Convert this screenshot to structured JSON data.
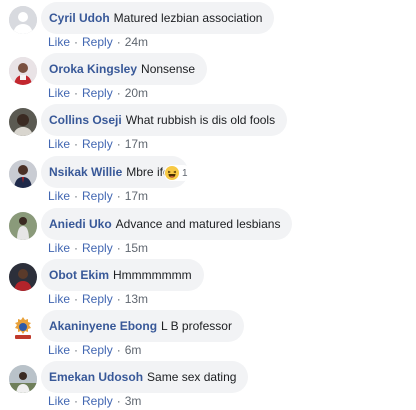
{
  "ui": {
    "like_label": "Like",
    "reply_label": "Reply",
    "separator": "·"
  },
  "comments": [
    {
      "author": "Cyril Udoh",
      "text": "Matured lezbian association",
      "time": "24m",
      "avatar_icon": "generic-user-icon"
    },
    {
      "author": "Oroka Kingsley",
      "text": "Nonsense",
      "time": "20m",
      "avatar_icon": "user-photo-red-shirt"
    },
    {
      "author": "Collins Oseji",
      "text": "What rubbish is dis old fools",
      "time": "17m",
      "avatar_icon": "user-photo-dark"
    },
    {
      "author": "Nsikak Willie",
      "text": "Mbre ifod",
      "time": "17m",
      "avatar_icon": "user-photo-suit",
      "reaction": {
        "icon": "haha-emoji-icon",
        "count": "1"
      }
    },
    {
      "author": "Aniedi Uko",
      "text": "Advance and matured lesbians",
      "time": "15m",
      "avatar_icon": "user-photo-standing"
    },
    {
      "author": "Obot Ekim",
      "text": "Hmmmmmmm",
      "time": "13m",
      "avatar_icon": "user-photo-red"
    },
    {
      "author": "Akaninyene Ebong",
      "text": "L B professor",
      "time": "6m",
      "avatar_icon": "emblem-logo"
    },
    {
      "author": "Emekan Udosoh",
      "text": "Same sex dating",
      "time": "3m",
      "avatar_icon": "user-photo-outdoor"
    }
  ],
  "colors": {
    "author": "#385898",
    "link": "#4267b2",
    "meta": "#606770",
    "bubble": "#f2f3f5"
  }
}
